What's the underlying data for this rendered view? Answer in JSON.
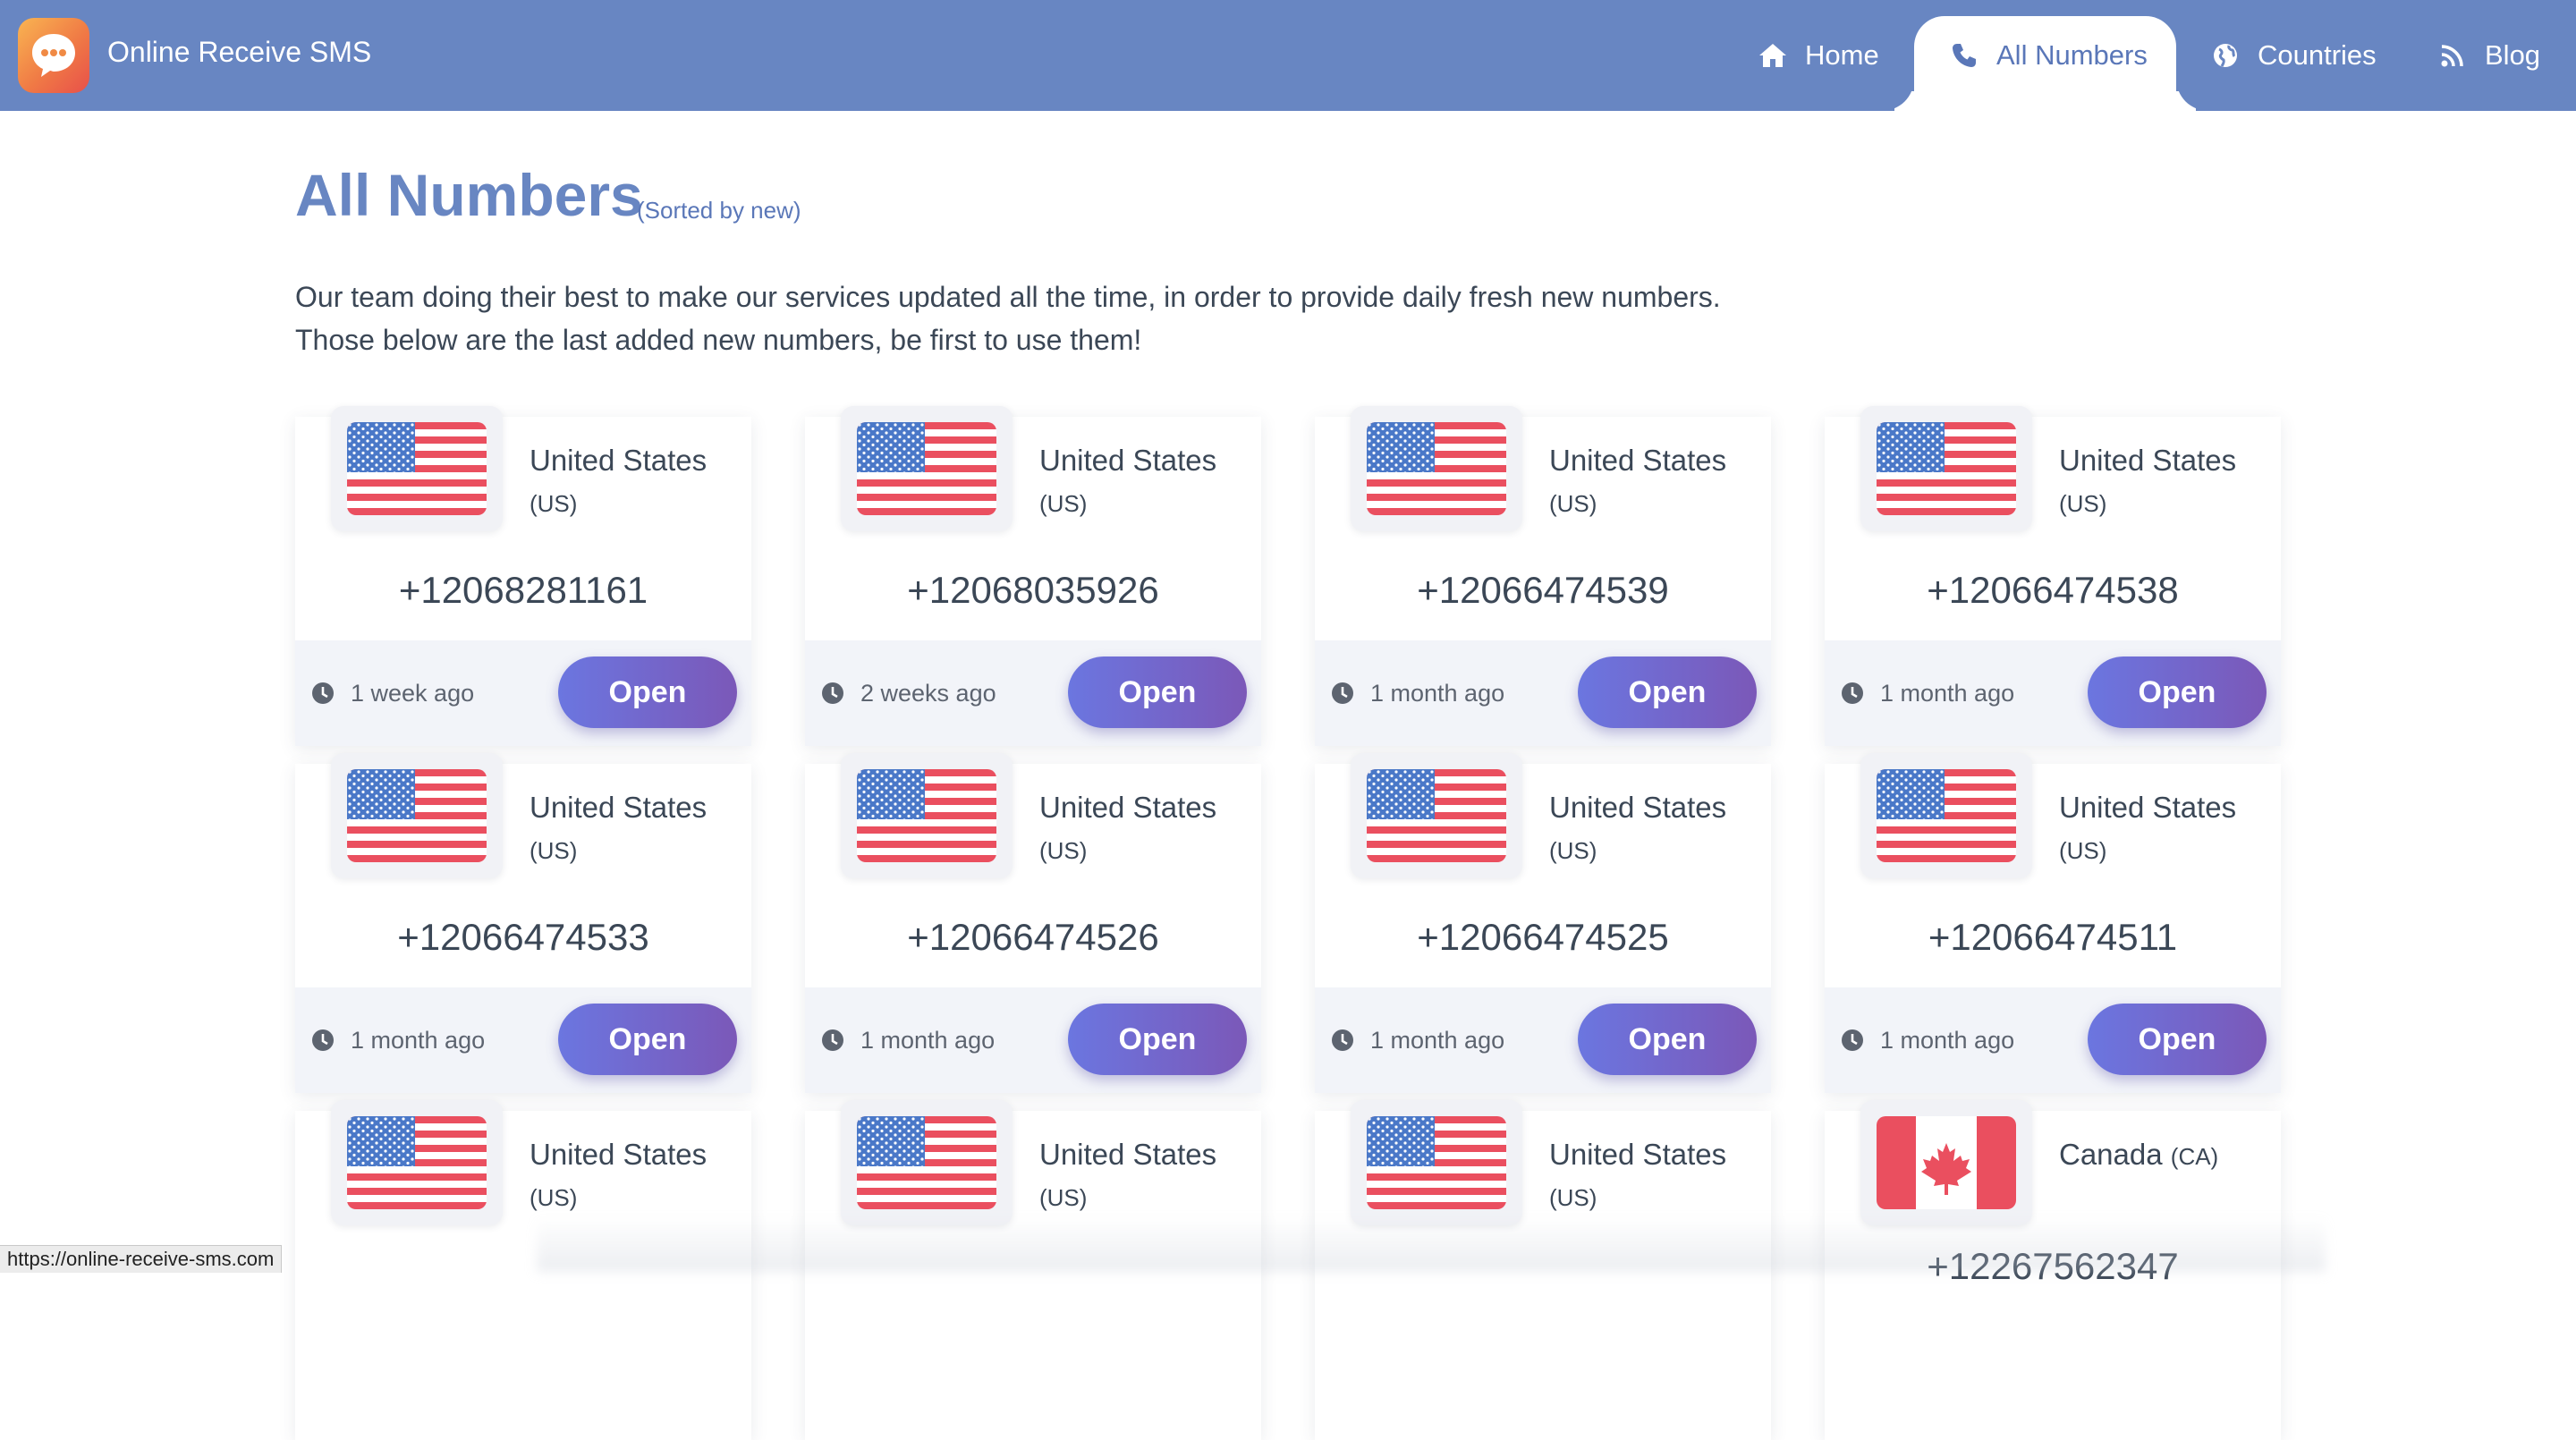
{
  "header": {
    "brand": "Online Receive SMS",
    "nav": [
      {
        "label": "Home",
        "icon": "home-icon",
        "active": false
      },
      {
        "label": "All Numbers",
        "icon": "phone-icon",
        "active": true
      },
      {
        "label": "Countries",
        "icon": "globe-icon",
        "active": false
      },
      {
        "label": "Blog",
        "icon": "rss-icon",
        "active": false
      }
    ]
  },
  "page": {
    "title": "All Numbers",
    "sorted_note": "(Sorted by new)",
    "intro_line1": "Our team doing their best to make our services updated all the time, in order to provide daily fresh new numbers.",
    "intro_line2": "Those below are the last added new numbers, be first to use them!"
  },
  "cards": [
    {
      "country": "United States",
      "code": "(US)",
      "flag": "us-flag-icon",
      "number": "+12068281161",
      "time": "1 week ago",
      "button": "Open"
    },
    {
      "country": "United States",
      "code": "(US)",
      "flag": "us-flag-icon",
      "number": "+12068035926",
      "time": "2 weeks ago",
      "button": "Open"
    },
    {
      "country": "United States",
      "code": "(US)",
      "flag": "us-flag-icon",
      "number": "+12066474539",
      "time": "1 month ago",
      "button": "Open"
    },
    {
      "country": "United States",
      "code": "(US)",
      "flag": "us-flag-icon",
      "number": "+12066474538",
      "time": "1 month ago",
      "button": "Open"
    },
    {
      "country": "United States",
      "code": "(US)",
      "flag": "us-flag-icon",
      "number": "+12066474533",
      "time": "1 month ago",
      "button": "Open"
    },
    {
      "country": "United States",
      "code": "(US)",
      "flag": "us-flag-icon",
      "number": "+12066474526",
      "time": "1 month ago",
      "button": "Open"
    },
    {
      "country": "United States",
      "code": "(US)",
      "flag": "us-flag-icon",
      "number": "+12066474525",
      "time": "1 month ago",
      "button": "Open"
    },
    {
      "country": "United States",
      "code": "(US)",
      "flag": "us-flag-icon",
      "number": "+12066474511",
      "time": "1 month ago",
      "button": "Open"
    },
    {
      "country": "United States",
      "code": "(US)",
      "flag": "us-flag-icon"
    },
    {
      "country": "United States",
      "code": "(US)",
      "flag": "us-flag-icon"
    },
    {
      "country": "United States",
      "code": "(US)",
      "flag": "us-flag-icon"
    },
    {
      "country": "Canada",
      "code": "(CA)",
      "flag": "ca-flag-icon",
      "number": "+12267562347"
    }
  ],
  "status_bar": {
    "url": "https://online-receive-sms.com"
  },
  "colors": {
    "header_bg": "#6886c2",
    "title": "#6886c2",
    "button_start": "#6b76e0",
    "button_end": "#7b58b8",
    "card_footer": "#f2f4f9"
  }
}
